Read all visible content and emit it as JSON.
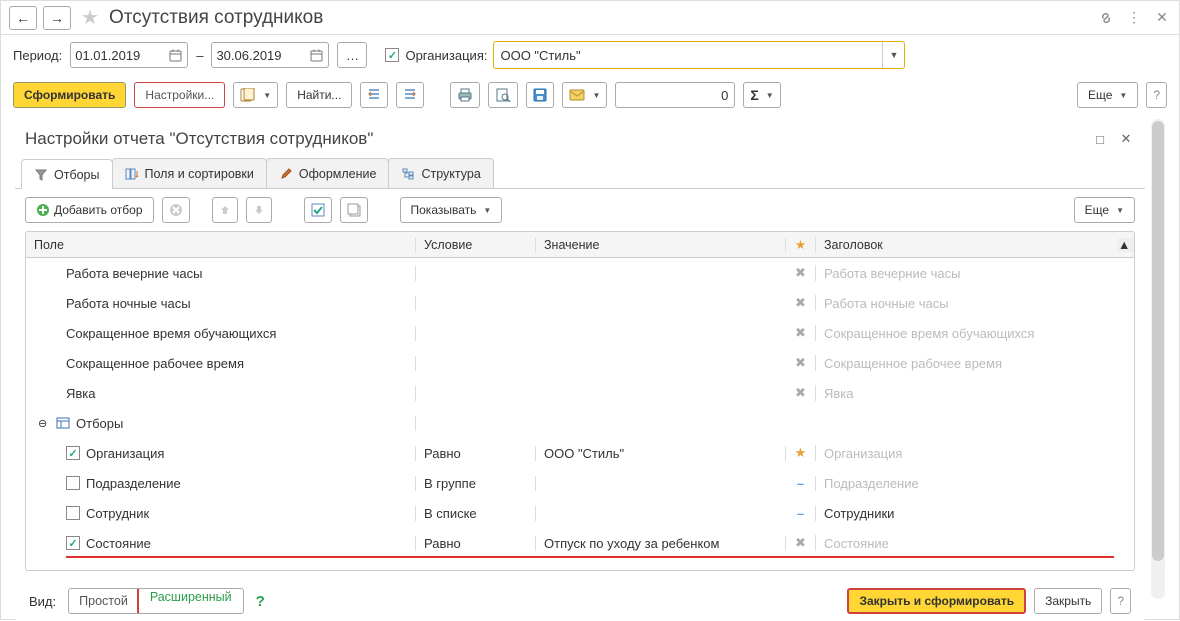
{
  "title": "Отсутствия сотрудников",
  "period": {
    "label": "Период:",
    "from": "01.01.2019",
    "sep": "–",
    "to": "30.06.2019"
  },
  "org_check_label": "Организация:",
  "org_value": "ООО \"Стиль\"",
  "toolbar": {
    "form": "Сформировать",
    "settings": "Настройки...",
    "find": "Найти...",
    "number": "0",
    "more": "Еще"
  },
  "panel": {
    "title": "Настройки отчета \"Отсутствия сотрудников\"",
    "tabs": {
      "filters": "Отборы",
      "fields": "Поля и сортировки",
      "design": "Оформление",
      "structure": "Структура"
    },
    "add_filter": "Добавить отбор",
    "show": "Показывать",
    "more": "Еще",
    "columns": {
      "field": "Поле",
      "cond": "Условие",
      "val": "Значение",
      "hdr": "Заголовок"
    },
    "rows": [
      {
        "type": "plain",
        "field": "Работа вечерние часы",
        "star": "x",
        "hdr": "Работа вечерние часы",
        "hdr_muted": true
      },
      {
        "type": "plain",
        "field": "Работа ночные часы",
        "star": "x",
        "hdr": "Работа ночные часы",
        "hdr_muted": true
      },
      {
        "type": "plain",
        "field": "Сокращенное время обучающихся",
        "star": "x",
        "hdr": "Сокращенное время обучающихся",
        "hdr_muted": true
      },
      {
        "type": "plain",
        "field": "Сокращенное рабочее время",
        "star": "x",
        "hdr": "Сокращенное рабочее время",
        "hdr_muted": true
      },
      {
        "type": "plain",
        "field": "Явка",
        "star": "x",
        "hdr": "Явка",
        "hdr_muted": true
      },
      {
        "type": "group",
        "field": "Отборы"
      },
      {
        "type": "filter",
        "checked": true,
        "field": "Организация",
        "cond": "Равно",
        "val": "ООО \"Стиль\"",
        "star": "star",
        "hdr": "Организация",
        "hdr_muted": true
      },
      {
        "type": "filter",
        "checked": false,
        "field": "Подразделение",
        "cond": "В группе",
        "val": "",
        "star": "dash",
        "hdr": "Подразделение",
        "hdr_muted": true
      },
      {
        "type": "filter",
        "checked": false,
        "field": "Сотрудник",
        "cond": "В списке",
        "val": "",
        "star": "dash",
        "hdr": "Сотрудники",
        "hdr_muted": false
      },
      {
        "type": "filter",
        "checked": true,
        "field": "Состояние",
        "cond": "Равно",
        "val": "Отпуск по уходу за ребенком",
        "star": "x",
        "hdr": "Состояние",
        "hdr_muted": true
      }
    ]
  },
  "footer": {
    "view": "Вид:",
    "simple": "Простой",
    "advanced": "Расширенный",
    "close_form": "Закрыть и сформировать",
    "close": "Закрыть"
  }
}
